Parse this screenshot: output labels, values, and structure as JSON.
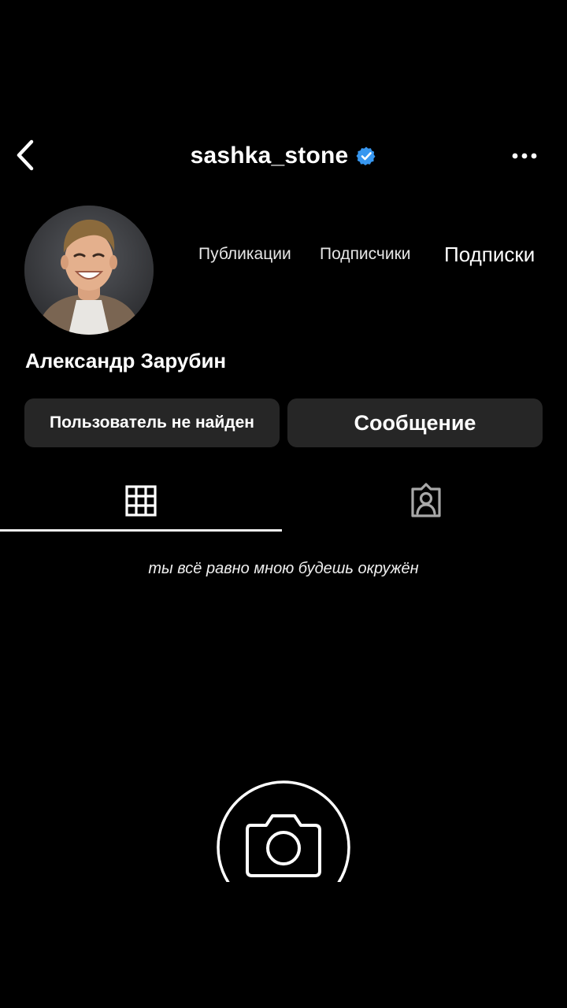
{
  "header": {
    "username": "sashka_stone",
    "back_icon": "chevron-left-icon",
    "verified_icon": "verified-badge-icon",
    "more_icon": "more-horizontal-icon",
    "verified_color": "#3797f0"
  },
  "profile": {
    "avatar_icon": "profile-avatar",
    "full_name": "Александр Зарубин",
    "stats": {
      "posts_label": "Публикации",
      "followers_label": "Подписчики",
      "following_label": "Подписки"
    },
    "bio": "ты всё равно мною будешь окружён"
  },
  "actions": {
    "left_button": "Пользователь не найден",
    "right_button": "Сообщение",
    "button_bg": "#262626"
  },
  "tabs": {
    "grid_icon": "grid-icon",
    "tagged_icon": "tagged-user-icon",
    "active": "grid"
  },
  "empty_state": {
    "icon": "camera-icon"
  }
}
